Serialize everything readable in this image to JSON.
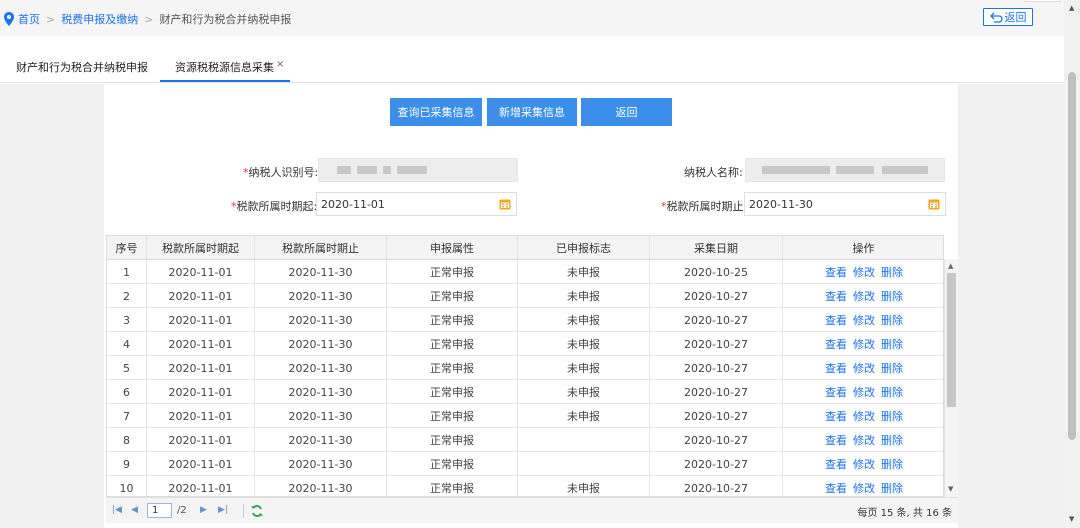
{
  "breadcrumb": {
    "home": "首页",
    "level2": "税费申报及缴纳",
    "current": "财产和行为税合并纳税申报",
    "separator": ">"
  },
  "back_button": {
    "label": "返回",
    "icon": "back-arrow-icon"
  },
  "tabs": [
    {
      "label": "财产和行为税合并纳税申报",
      "active": false
    },
    {
      "label": "资源税税源信息采集",
      "active": true,
      "close_symbol": "×"
    }
  ],
  "actions": {
    "query_label": "查询已采集信息",
    "new_label": "新增采集信息",
    "return_label": "返回"
  },
  "form": {
    "taxpayer_id_label": "纳税人识别号:",
    "taxpayer_name_label": "纳税人名称:",
    "period_start_label": "税款所属时期起:",
    "period_start_value": "2020-11-01",
    "period_end_label": "税款所属时期止:",
    "period_end_value": "2020-11-30",
    "required_mark": "*"
  },
  "table": {
    "headers": [
      "序号",
      "税款所属时期起",
      "税款所属时期止",
      "申报属性",
      "已申报标志",
      "采集日期",
      "操作"
    ],
    "op_view": "查看",
    "op_edit": "修改",
    "op_delete": "删除",
    "rows": [
      [
        "1",
        "2020-11-01",
        "2020-11-30",
        "正常申报",
        "未申报",
        "2020-10-25"
      ],
      [
        "2",
        "2020-11-01",
        "2020-11-30",
        "正常申报",
        "未申报",
        "2020-10-27"
      ],
      [
        "3",
        "2020-11-01",
        "2020-11-30",
        "正常申报",
        "未申报",
        "2020-10-27"
      ],
      [
        "4",
        "2020-11-01",
        "2020-11-30",
        "正常申报",
        "未申报",
        "2020-10-27"
      ],
      [
        "5",
        "2020-11-01",
        "2020-11-30",
        "正常申报",
        "未申报",
        "2020-10-27"
      ],
      [
        "6",
        "2020-11-01",
        "2020-11-30",
        "正常申报",
        "未申报",
        "2020-10-27"
      ],
      [
        "7",
        "2020-11-01",
        "2020-11-30",
        "正常申报",
        "未申报",
        "2020-10-27"
      ],
      [
        "8",
        "2020-11-01",
        "2020-11-30",
        "正常申报",
        "",
        "2020-10-27"
      ],
      [
        "9",
        "2020-11-01",
        "2020-11-30",
        "正常申报",
        "",
        "2020-10-27"
      ],
      [
        "10",
        "2020-11-01",
        "2020-11-30",
        "正常申报",
        "未申报",
        "2020-10-27"
      ]
    ]
  },
  "pager": {
    "current_page": "1",
    "total_pages": "/2",
    "summary": "每页 15 条, 共 16 条"
  },
  "colors": {
    "accent": "#1a73e8",
    "button": "#3b8fe8",
    "required": "#e33333"
  }
}
